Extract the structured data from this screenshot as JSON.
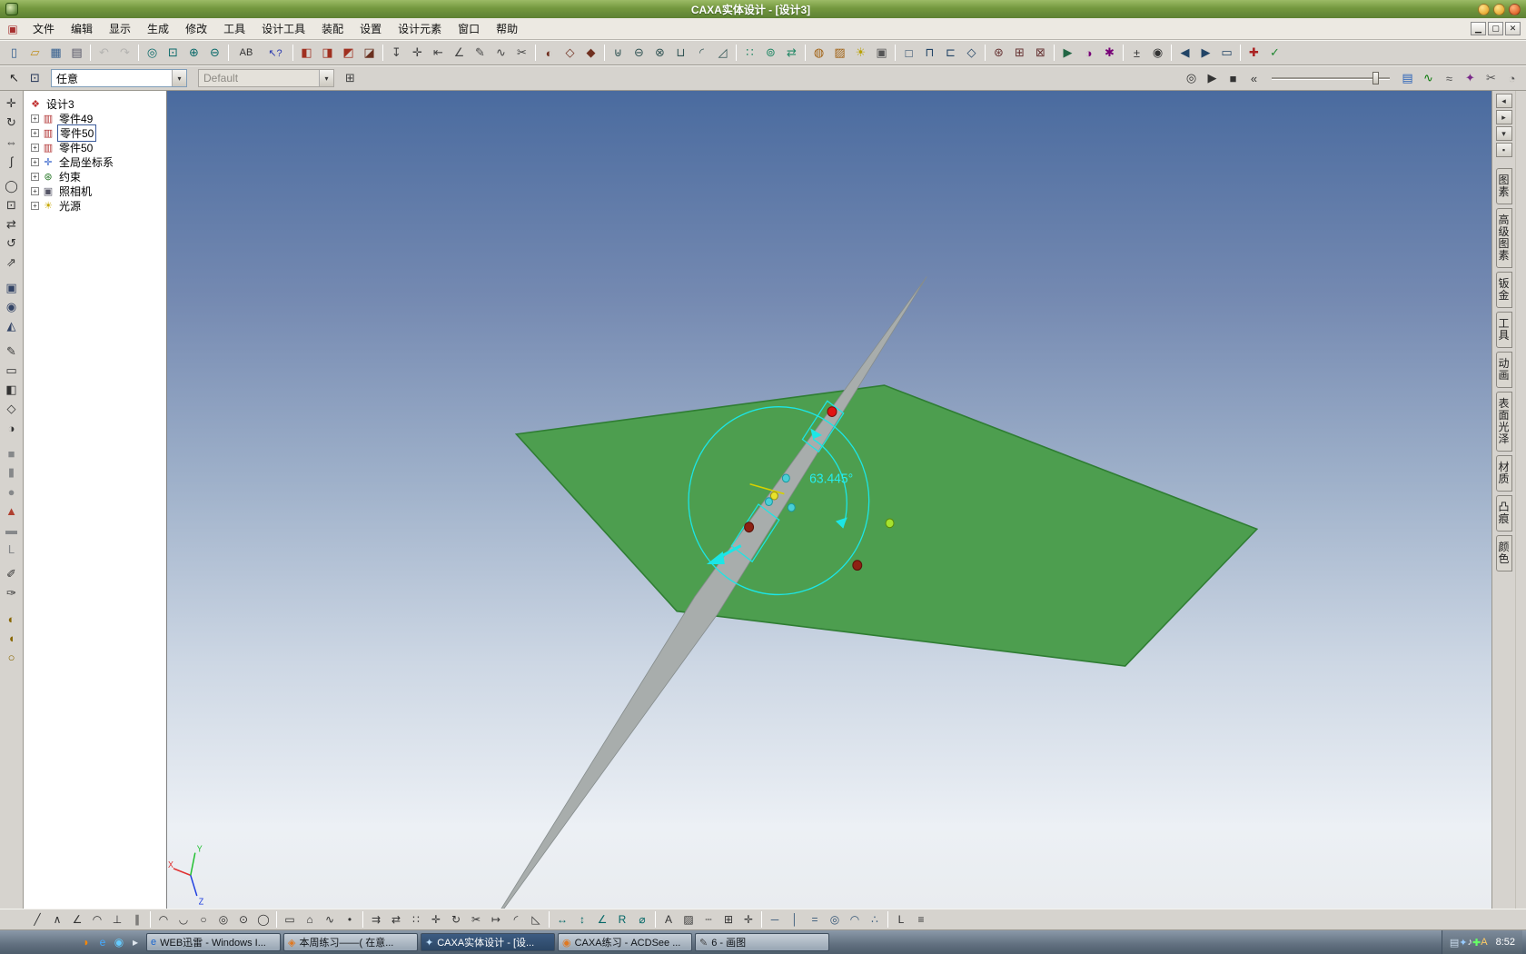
{
  "titlebar": {
    "title": "CAXA实体设计 - [设计3]",
    "controls": [
      {
        "n": "minimize",
        "k": "amber"
      },
      {
        "n": "maximize",
        "k": "amber"
      },
      {
        "n": "close",
        "k": "red"
      }
    ]
  },
  "menubar": {
    "items": [
      "文件",
      "编辑",
      "显示",
      "生成",
      "修改",
      "工具",
      "设计工具",
      "装配",
      "设置",
      "设计元素",
      "窗口",
      "帮助"
    ],
    "mdi": [
      {
        "n": "mdi-minimize",
        "g": "▁"
      },
      {
        "n": "mdi-restore",
        "g": "▢"
      },
      {
        "n": "mdi-close",
        "g": "✕"
      }
    ]
  },
  "toolbars": {
    "main": [
      {
        "n": "new-file",
        "g": "▯",
        "c": "#335e8e"
      },
      {
        "n": "open-file",
        "g": "▱",
        "c": "#c09020"
      },
      {
        "n": "save-file",
        "g": "▦",
        "c": "#335e8e"
      },
      {
        "n": "print",
        "g": "▤",
        "c": "#555566"
      },
      {
        "sep": true
      },
      {
        "n": "undo",
        "g": "↶",
        "c": "#9a9a9a",
        "d": 1
      },
      {
        "n": "redo",
        "g": "↷",
        "c": "#9a9a9a",
        "d": 1
      },
      {
        "sep": true
      },
      {
        "n": "zoom-fit",
        "g": "◎",
        "c": "#0a6a6a"
      },
      {
        "n": "zoom-window",
        "g": "⊡",
        "c": "#0a6a6a"
      },
      {
        "n": "zoom-in",
        "g": "⊕",
        "c": "#0a6a6a"
      },
      {
        "n": "zoom-out",
        "g": "⊖",
        "c": "#0a6a6a"
      },
      {
        "sep": true
      },
      {
        "n": "find-text",
        "g": "AB",
        "c": "#333333",
        "wide": 1
      },
      {
        "n": "context-help",
        "g": "↖?",
        "c": "#2a3ab0",
        "wide": 1
      },
      {
        "sep": true
      },
      {
        "n": "extrude-feature",
        "g": "◧",
        "c": "#a03020"
      },
      {
        "n": "revolve-feature",
        "g": "◨",
        "c": "#a03020"
      },
      {
        "n": "sweep-feature",
        "g": "◩",
        "c": "#a03020"
      },
      {
        "n": "loft-feature",
        "g": "◪",
        "c": "#6a3020"
      },
      {
        "sep": true
      },
      {
        "n": "anchor-tool",
        "g": "↧",
        "c": "#444444"
      },
      {
        "n": "smart-snap",
        "g": "✛",
        "c": "#444444"
      },
      {
        "n": "dimension-tool",
        "g": "⇤",
        "c": "#444444"
      },
      {
        "n": "measure-angle",
        "g": "∠",
        "c": "#444444"
      },
      {
        "n": "sketch-2d",
        "g": "✎",
        "c": "#444444"
      },
      {
        "n": "spline-tool",
        "g": "∿",
        "c": "#444444"
      },
      {
        "n": "delete-tool",
        "g": "✂",
        "c": "#444444"
      },
      {
        "sep": true
      },
      {
        "n": "shade-mode",
        "g": "◐",
        "c": "#703020"
      },
      {
        "n": "wireframe-mode",
        "g": "◇",
        "c": "#703020"
      },
      {
        "n": "hidden-line-mode",
        "g": "◆",
        "c": "#703020"
      },
      {
        "sep": true
      },
      {
        "n": "boolean-union",
        "g": "⊎",
        "c": "#335555"
      },
      {
        "n": "boolean-subtract",
        "g": "⊖",
        "c": "#335555"
      },
      {
        "n": "boolean-intersect",
        "g": "⊗",
        "c": "#335555"
      },
      {
        "n": "shell-feature",
        "g": "⊔",
        "c": "#335555"
      },
      {
        "n": "fillet-feature",
        "g": "◜",
        "c": "#335555"
      },
      {
        "n": "chamfer-feature",
        "g": "◿",
        "c": "#335555"
      },
      {
        "sep": true
      },
      {
        "n": "pattern-linear",
        "g": "∷",
        "c": "#228866"
      },
      {
        "n": "pattern-circular",
        "g": "⊚",
        "c": "#228866"
      },
      {
        "n": "mirror-feature",
        "g": "⇄",
        "c": "#228866"
      },
      {
        "sep": true
      },
      {
        "n": "material-tool",
        "g": "◍",
        "c": "#a06010"
      },
      {
        "n": "texture-tool",
        "g": "▨",
        "c": "#a06010"
      },
      {
        "n": "light-tool",
        "g": "☀",
        "c": "#b8a000"
      },
      {
        "n": "camera-tool",
        "g": "▣",
        "c": "#555555"
      },
      {
        "sep": true
      },
      {
        "n": "view-front",
        "g": "□",
        "c": "#224466"
      },
      {
        "n": "view-top",
        "g": "⊓",
        "c": "#224466"
      },
      {
        "n": "view-left",
        "g": "⊏",
        "c": "#224466"
      },
      {
        "n": "view-iso",
        "g": "◇",
        "c": "#224466"
      },
      {
        "sep": true
      },
      {
        "n": "constraint-tool",
        "g": "⊛",
        "c": "#663333"
      },
      {
        "n": "assembly-tool",
        "g": "⊞",
        "c": "#663333"
      },
      {
        "n": "interference-check",
        "g": "⊠",
        "c": "#663333"
      },
      {
        "sep": true
      },
      {
        "n": "animation-tool",
        "g": "▶",
        "c": "#226644"
      },
      {
        "n": "render-tool",
        "g": "◑",
        "c": "#770077"
      },
      {
        "n": "options-tool",
        "g": "✱",
        "c": "#770077"
      },
      {
        "sep": true
      },
      {
        "n": "toggle-dimension",
        "g": "±",
        "c": "#333333"
      },
      {
        "n": "update-view",
        "g": "◉",
        "c": "#333333"
      },
      {
        "sep": true
      },
      {
        "n": "page-prev",
        "g": "◀",
        "c": "#224466"
      },
      {
        "n": "page-next",
        "g": "▶",
        "c": "#224466"
      },
      {
        "n": "page-setup",
        "g": "▭",
        "c": "#224466"
      },
      {
        "sep": true
      },
      {
        "n": "repair-tool",
        "g": "✚",
        "c": "#aa2222"
      },
      {
        "n": "analyze-tool",
        "g": "✓",
        "c": "#228833"
      }
    ],
    "view": {
      "filter_value": "任意",
      "style_value": "Default",
      "left_icons": [
        {
          "n": "select-cursor",
          "g": "↖",
          "c": "#222222"
        },
        {
          "n": "pick-filter",
          "g": "⊡",
          "c": "#223355"
        }
      ],
      "mid_icons": [
        {
          "n": "assembly-tree",
          "g": "⊞",
          "c": "#444444"
        }
      ],
      "playback_icons": [
        {
          "n": "loop-mode",
          "g": "◎",
          "c": "#333333"
        },
        {
          "n": "play",
          "g": "▶",
          "c": "#333333"
        },
        {
          "n": "stop",
          "g": "■",
          "c": "#333333"
        },
        {
          "n": "rewind",
          "g": "«",
          "c": "#333333"
        }
      ],
      "right_icons": [
        {
          "n": "drawing-sheet",
          "g": "▤",
          "c": "#2a62b8"
        },
        {
          "n": "curve-edit",
          "g": "∿",
          "c": "#0a7a0a"
        },
        {
          "n": "smooth-tool",
          "g": "≈",
          "c": "#555555"
        },
        {
          "n": "render-options",
          "g": "✦",
          "c": "#7a2a8a"
        },
        {
          "n": "scissors",
          "g": "✂",
          "c": "#555555"
        },
        {
          "n": "display-settings",
          "g": "◔",
          "c": "#555555"
        }
      ]
    }
  },
  "left_toolbar": [
    {
      "n": "move-tool",
      "g": "✛",
      "c": "#333333"
    },
    {
      "n": "rotate-tool",
      "g": "↻",
      "c": "#333333"
    },
    {
      "n": "hand-tool",
      "g": "⇔",
      "c": "#333333"
    },
    {
      "n": "curve-tool",
      "g": "∫",
      "c": "#333333"
    },
    {
      "gap": true
    },
    {
      "n": "zoom-tool",
      "g": "◯",
      "c": "#333333"
    },
    {
      "n": "zoom-region",
      "g": "⊡",
      "c": "#333333"
    },
    {
      "n": "pan-tool",
      "g": "⇄",
      "c": "#333333"
    },
    {
      "n": "orbit-tool",
      "g": "↺",
      "c": "#333333"
    },
    {
      "n": "fly-tool",
      "g": "⇗",
      "c": "#333333"
    },
    {
      "gap": true
    },
    {
      "n": "camera-view",
      "g": "▣",
      "c": "#334466"
    },
    {
      "n": "look-at",
      "g": "◉",
      "c": "#334466"
    },
    {
      "n": "perspective-toggle",
      "g": "◭",
      "c": "#334466"
    },
    {
      "gap": true
    },
    {
      "n": "edit-sketch",
      "g": "✎",
      "c": "#333333"
    },
    {
      "n": "edit-cross-section",
      "g": "▭",
      "c": "#333333"
    },
    {
      "n": "edit-surface",
      "g": "◧",
      "c": "#333333"
    },
    {
      "n": "wireframe-toggle",
      "g": "◇",
      "c": "#333333"
    },
    {
      "n": "smooth-shade",
      "g": "◑",
      "c": "#333333"
    },
    {
      "gap": true
    },
    {
      "n": "box-primitive",
      "g": "■",
      "c": "#86888a"
    },
    {
      "n": "cylinder-primitive",
      "g": "▮",
      "c": "#86888a"
    },
    {
      "n": "sphere-primitive",
      "g": "●",
      "c": "#86888a"
    },
    {
      "n": "cone-primitive",
      "g": "▲",
      "c": "#b04030"
    },
    {
      "n": "slab-primitive",
      "g": "▬",
      "c": "#86888a"
    },
    {
      "n": "l-profile",
      "g": "L",
      "c": "#86888a"
    },
    {
      "gap": true
    },
    {
      "n": "eyedropper",
      "g": "✐",
      "c": "#333333"
    },
    {
      "n": "format-brush",
      "g": "✑",
      "c": "#333333"
    },
    {
      "gap": true
    },
    {
      "n": "spotlight-tool",
      "g": "◐",
      "c": "#886600"
    },
    {
      "n": "flashlight-tool",
      "g": "◖",
      "c": "#886600"
    },
    {
      "n": "ambient-light",
      "g": "○",
      "c": "#886600"
    }
  ],
  "tree": {
    "items": [
      {
        "label": "设计3",
        "icon": "design-root",
        "glyph": "❖",
        "color": "#c03030",
        "root": true
      },
      {
        "label": "零件49",
        "icon": "part",
        "glyph": "▥",
        "color": "#b03030"
      },
      {
        "label": "零件50",
        "icon": "part",
        "glyph": "▥",
        "color": "#b03030",
        "selected": true
      },
      {
        "label": "零件50",
        "icon": "part",
        "glyph": "▥",
        "color": "#b03030"
      },
      {
        "label": "全局坐标系",
        "icon": "coordinate-system",
        "glyph": "✛",
        "color": "#2858c8"
      },
      {
        "label": "约束",
        "icon": "constraints",
        "glyph": "⊛",
        "color": "#287828"
      },
      {
        "label": "照相机",
        "icon": "camera",
        "glyph": "▣",
        "color": "#555566"
      },
      {
        "label": "光源",
        "icon": "light",
        "glyph": "☀",
        "color": "#c8a800"
      }
    ]
  },
  "viewport": {
    "rotation_angle_label": "63.445°",
    "triad": {
      "x": "X",
      "y": "Y",
      "z": "Z"
    }
  },
  "right_panel": {
    "top_buttons": [
      {
        "n": "scroll-left",
        "g": "◂",
        "c": "#333333"
      },
      {
        "n": "scroll-right",
        "g": "▸",
        "c": "#333333"
      },
      {
        "n": "panel-pin",
        "g": "▾",
        "c": "#333333"
      },
      {
        "n": "panel-options",
        "g": "▪",
        "c": "#333333"
      }
    ],
    "tabs": [
      "图素",
      "高级图素",
      "钣金",
      "工具",
      "动画",
      "表面光泽",
      "材质",
      "凸痕",
      "颜色"
    ]
  },
  "bottom_toolbar": [
    {
      "n": "line-two-point",
      "g": "╱",
      "c": "#333333"
    },
    {
      "n": "line-continuous",
      "g": "∧",
      "c": "#333333"
    },
    {
      "n": "line-angle",
      "g": "∠",
      "c": "#333333"
    },
    {
      "n": "line-tangent",
      "g": "◠",
      "c": "#333333"
    },
    {
      "n": "line-perpendicular",
      "g": "⊥",
      "c": "#333333"
    },
    {
      "n": "line-parallel",
      "g": "∥",
      "c": "#333333"
    },
    {
      "sep": true
    },
    {
      "n": "arc-three-point",
      "g": "◠",
      "c": "#333333"
    },
    {
      "n": "arc-center-radius",
      "g": "◡",
      "c": "#333333"
    },
    {
      "n": "circle-center",
      "g": "○",
      "c": "#333333"
    },
    {
      "n": "circle-two-point",
      "g": "◎",
      "c": "#333333"
    },
    {
      "n": "circle-three-point",
      "g": "⊙",
      "c": "#333333"
    },
    {
      "n": "ellipse-tool",
      "g": "◯",
      "c": "#333333"
    },
    {
      "sep": true
    },
    {
      "n": "rectangle-tool",
      "g": "▭",
      "c": "#333333"
    },
    {
      "n": "polygon-tool",
      "g": "⌂",
      "c": "#333333"
    },
    {
      "n": "spline-2d",
      "g": "∿",
      "c": "#333333"
    },
    {
      "n": "point-tool",
      "g": "•",
      "c": "#333333"
    },
    {
      "sep": true
    },
    {
      "n": "offset-2d",
      "g": "⇉",
      "c": "#333333"
    },
    {
      "n": "mirror-2d",
      "g": "⇄",
      "c": "#333333"
    },
    {
      "n": "array-2d",
      "g": "∷",
      "c": "#333333"
    },
    {
      "n": "move-2d",
      "g": "✛",
      "c": "#333333"
    },
    {
      "n": "rotate-2d",
      "g": "↻",
      "c": "#333333"
    },
    {
      "n": "trim-2d",
      "g": "✂",
      "c": "#333333"
    },
    {
      "n": "extend-2d",
      "g": "↦",
      "c": "#333333"
    },
    {
      "n": "fillet-2d",
      "g": "◜",
      "c": "#333333"
    },
    {
      "n": "chamfer-2d",
      "g": "◺",
      "c": "#333333"
    },
    {
      "sep": true
    },
    {
      "n": "dim-linear",
      "g": "↔",
      "c": "#006666"
    },
    {
      "n": "dim-vertical",
      "g": "↕",
      "c": "#006666"
    },
    {
      "n": "dim-angle",
      "g": "∠",
      "c": "#006666"
    },
    {
      "n": "dim-radius",
      "g": "R",
      "c": "#006666"
    },
    {
      "n": "dim-diameter",
      "g": "⌀",
      "c": "#006666"
    },
    {
      "sep": true
    },
    {
      "n": "text-2d",
      "g": "A",
      "c": "#333333"
    },
    {
      "n": "hatch-2d",
      "g": "▨",
      "c": "#333333"
    },
    {
      "n": "construction-line",
      "g": "┄",
      "c": "#333333"
    },
    {
      "n": "grid-toggle",
      "g": "⊞",
      "c": "#333333"
    },
    {
      "n": "snap-toggle",
      "g": "✛",
      "c": "#333333"
    },
    {
      "sep": true
    },
    {
      "n": "constraint-horizontal",
      "g": "─",
      "c": "#335577"
    },
    {
      "n": "constraint-vertical",
      "g": "│",
      "c": "#335577"
    },
    {
      "n": "constraint-equal",
      "g": "=",
      "c": "#335577"
    },
    {
      "n": "constraint-concentric",
      "g": "◎",
      "c": "#335577"
    },
    {
      "n": "constraint-tangent",
      "g": "◠",
      "c": "#335577"
    },
    {
      "n": "constraint-symmetric",
      "g": "∴",
      "c": "#335577"
    },
    {
      "sep": true
    },
    {
      "n": "ortho-mode",
      "g": "L",
      "c": "#333333"
    },
    {
      "n": "sketch-properties",
      "g": "≡",
      "c": "#333333"
    }
  ],
  "taskbar": {
    "quick_launch": [
      {
        "n": "xunlei",
        "g": "◗",
        "c": "#ff8800"
      },
      {
        "n": "internet-explorer",
        "g": "e",
        "c": "#44aaff"
      },
      {
        "n": "media-player",
        "g": "◉",
        "c": "#66ccff"
      },
      {
        "n": "quick-launch-chevron",
        "g": "▸",
        "c": "#dfe6ee"
      }
    ],
    "tasks": [
      {
        "label": "WEB迅雷 - Windows I...",
        "icon": "internet-explorer",
        "glyph": "e",
        "color": "#1a66cc"
      },
      {
        "label": "本周练习——( 在意...",
        "icon": "browser-doc",
        "glyph": "◈",
        "color": "#e07820"
      },
      {
        "label": "CAXA实体设计 - [设...",
        "icon": "caxa",
        "glyph": "✦",
        "color": "#bde0ff",
        "active": true
      },
      {
        "label": "CAXA练习 - ACDSee ...",
        "icon": "acdsee",
        "glyph": "◉",
        "color": "#e07820"
      },
      {
        "label": "6 - 画图",
        "icon": "paint",
        "glyph": "✎",
        "color": "#444444"
      }
    ],
    "tray": [
      {
        "n": "tray-scanner",
        "g": "▤",
        "c": "#ccddee"
      },
      {
        "n": "tray-caxa",
        "g": "✦",
        "c": "#99ccff"
      },
      {
        "n": "tray-volume",
        "g": "♪",
        "c": "#eeeeee"
      },
      {
        "n": "tray-antivirus",
        "g": "✚",
        "c": "#66ff66"
      },
      {
        "n": "tray-ime",
        "g": "A",
        "c": "#ffcc66"
      }
    ],
    "clock": "8:52"
  },
  "colors": {
    "titlebar_green": "#74983f",
    "viewport_top": "#4a6b9f",
    "viewport_bottom": "#e9ecef",
    "plate_green": "#4d9e4f",
    "needle_gray": "#a8adac",
    "manipulator_cyan": "#1ce6e6",
    "taskbar_active": "#2b4665"
  }
}
